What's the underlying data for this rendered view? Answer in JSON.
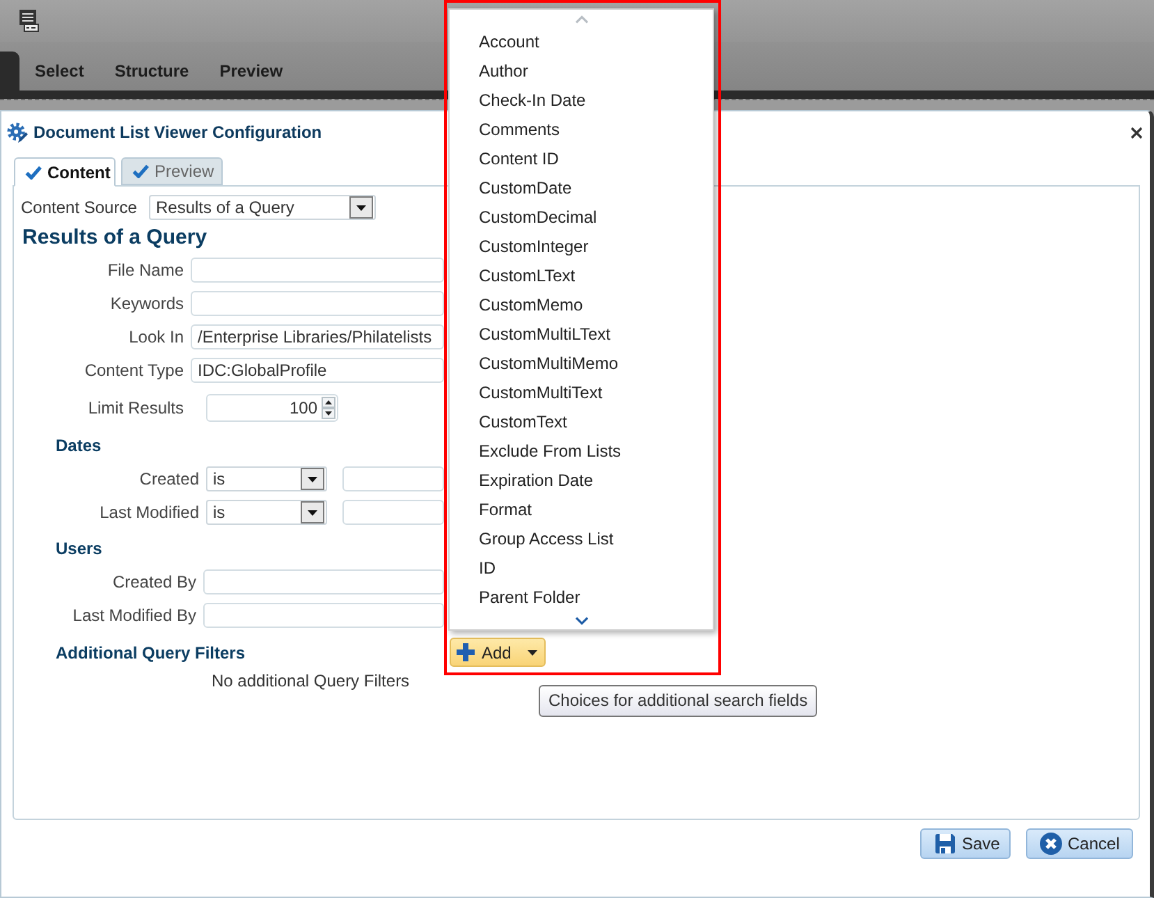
{
  "app_tabs": [
    {
      "label": "Select",
      "selected": false
    },
    {
      "label": "Structure",
      "selected": false
    },
    {
      "label": "Preview",
      "selected": false
    }
  ],
  "dialog": {
    "title": "Document List Viewer Configuration"
  },
  "dialog_tabs": [
    {
      "label": "Content",
      "selected": true
    },
    {
      "label": "Preview",
      "selected": false
    }
  ],
  "content_source": {
    "label": "Content Source",
    "value": "Results of a Query"
  },
  "query": {
    "heading": "Results of a Query",
    "fields": [
      {
        "kind": "text",
        "label": "File Name"
      },
      {
        "kind": "text",
        "label": "Keywords"
      },
      {
        "kind": "text",
        "label": "Look In",
        "value": "/Enterprise Libraries/Philatelists"
      },
      {
        "kind": "text",
        "label": "Content Type",
        "value": "IDC:GlobalProfile"
      },
      {
        "kind": "spinner",
        "label": "Limit Results",
        "value": "100"
      }
    ]
  },
  "dates": {
    "heading": "Dates",
    "rows": [
      {
        "label": "Created",
        "operator": "is"
      },
      {
        "label": "Last Modified",
        "operator": "is"
      }
    ]
  },
  "users": {
    "heading": "Users",
    "fields": [
      {
        "label": "Created By"
      },
      {
        "label": "Last Modified By"
      }
    ]
  },
  "additional_filters": {
    "heading": "Additional Query Filters",
    "add_button": "Add",
    "empty_message": "No additional Query Filters"
  },
  "field_menu": {
    "scroll_up_disabled": true,
    "scroll_down_disabled": false,
    "items": [
      "Account",
      "Author",
      "Check-In Date",
      "Comments",
      "Content ID",
      "CustomDate",
      "CustomDecimal",
      "CustomInteger",
      "CustomLText",
      "CustomMemo",
      "CustomMultiLText",
      "CustomMultiMemo",
      "CustomMultiText",
      "CustomText",
      "Exclude From Lists",
      "Expiration Date",
      "Format",
      "Group Access List",
      "ID",
      "Parent Folder"
    ]
  },
  "tooltip": "Choices for additional search fields",
  "buttons": [
    {
      "kind": "save",
      "label": "Save"
    },
    {
      "kind": "cancel",
      "label": "Cancel"
    }
  ]
}
